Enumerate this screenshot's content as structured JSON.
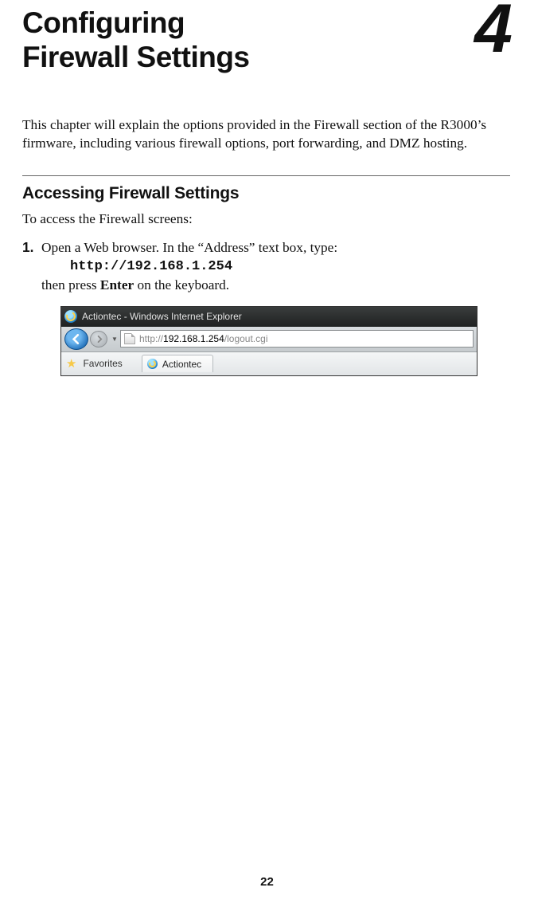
{
  "chapter": {
    "title_line1": "Configuring",
    "title_line2": "Firewall Settings",
    "number": "4"
  },
  "intro": "This chapter will explain the options provided in the Firewall section of the R3000’s firmware, including various firewall options, port forwarding, and DMZ hosting.",
  "section1": {
    "heading": "Accessing Firewall Settings",
    "lead": "To access the Firewall screens:",
    "step1": {
      "num": "1.",
      "text_a": "Open a Web browser. In the “Address” text box, type:",
      "code": "http://192.168.1.254",
      "text_b1": "then press ",
      "text_b_bold": "Enter",
      "text_b2": " on the keyboard."
    }
  },
  "browser": {
    "title": "Actiontec - Windows Internet Explorer",
    "url_prefix": "http://",
    "url_host": "192.168.1.254",
    "url_path": "/logout.cgi",
    "favorites": "Favorites",
    "tab": "Actiontec"
  },
  "page_number": "22"
}
